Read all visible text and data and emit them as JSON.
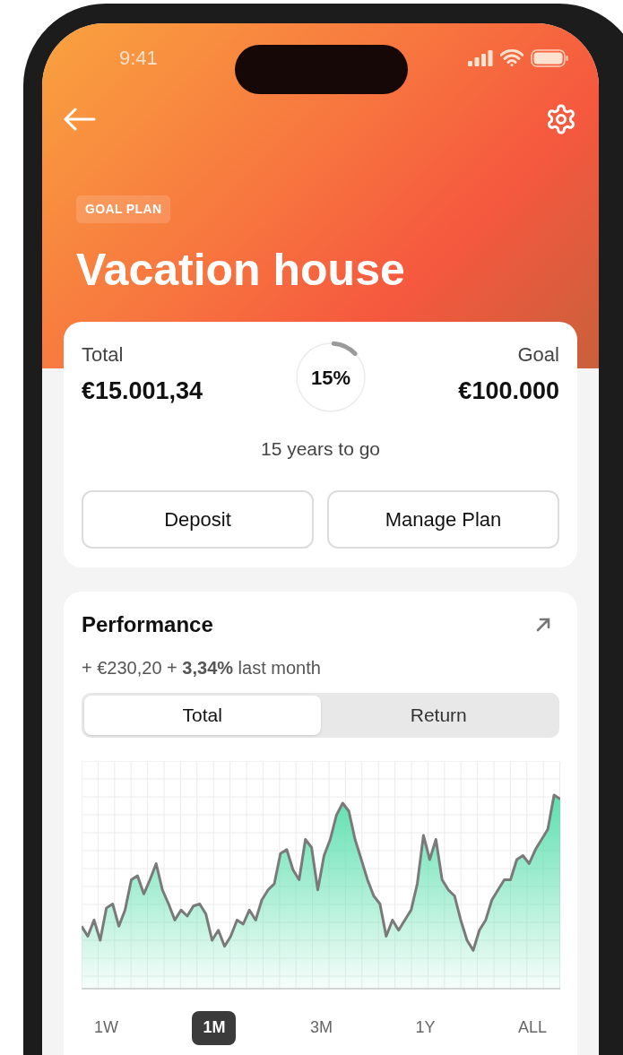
{
  "status_bar": {
    "time": "9:41"
  },
  "header": {
    "badge": "GOAL PLAN",
    "title": "Vacation house"
  },
  "summary": {
    "total_label": "Total",
    "total_value": "€15.001,34",
    "progress": {
      "level": 0.15,
      "label": "15%"
    },
    "goal_label": "Goal",
    "goal_value": "€100.000",
    "remaining": "15 years to go",
    "buttons": [
      "Deposit",
      "Manage Plan"
    ]
  },
  "performance": {
    "title": "Performance",
    "change": "+ €230,20 + **3,34%** last month",
    "tabs": [
      {
        "label": "Total",
        "selected": true
      },
      {
        "label": "Return",
        "selected": false
      }
    ],
    "periods": [
      {
        "label": "1W",
        "selected": false
      },
      {
        "label": "1M",
        "selected": true
      },
      {
        "label": "3M",
        "selected": false
      },
      {
        "label": "1Y",
        "selected": false
      },
      {
        "label": "ALL",
        "selected": false
      }
    ]
  }
}
